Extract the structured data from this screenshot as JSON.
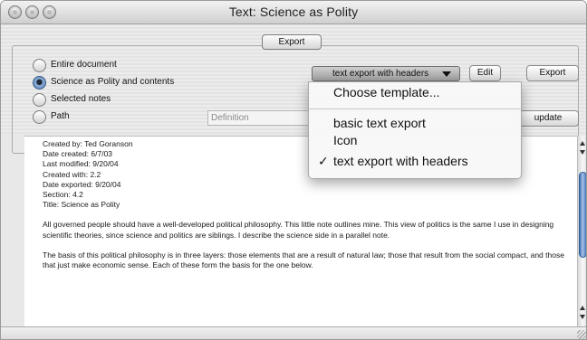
{
  "window": {
    "title": "Text: Science as Polity"
  },
  "toolbar": {
    "export_tab": "Export"
  },
  "options": {
    "radios": [
      {
        "label": "Entire document",
        "checked": false
      },
      {
        "label": "Science as Polity and contents",
        "checked": true
      },
      {
        "label": "Selected notes",
        "checked": false
      },
      {
        "label": "Path",
        "checked": false
      }
    ],
    "path_field_placeholder": "Definition",
    "template_select": {
      "value": "text export with headers"
    },
    "edit_label": "Edit",
    "export_label": "Export",
    "update_label": "update"
  },
  "menu": {
    "items": [
      {
        "label": "Choose template...",
        "checked": false
      },
      {
        "label": "basic text export",
        "checked": false
      },
      {
        "label": "Icon",
        "checked": false
      },
      {
        "label": "text export with headers",
        "checked": true
      }
    ],
    "check_glyph": "✓"
  },
  "document": {
    "meta": [
      "Created by:  Ted Goranson",
      "Date created:  6/7/03",
      "Last modified:  9/20/04",
      "Created with:  2.2",
      "Date exported:     9/20/04",
      "Section:  4.2",
      "Title:  Science as Polity"
    ],
    "paragraphs": [
      "All governed people should have a well-developed political philosophy. This little note outlines mine. This view of politics is the same I use in designing scientific theories, since science and politics are siblings. I describe the science side in a parallel note.",
      "The basis of this political philosophy is in three layers: those elements that are a result of natural law; those that result from the social compact, and those that just make economic sense. Each of these form the basis for the one below."
    ]
  }
}
